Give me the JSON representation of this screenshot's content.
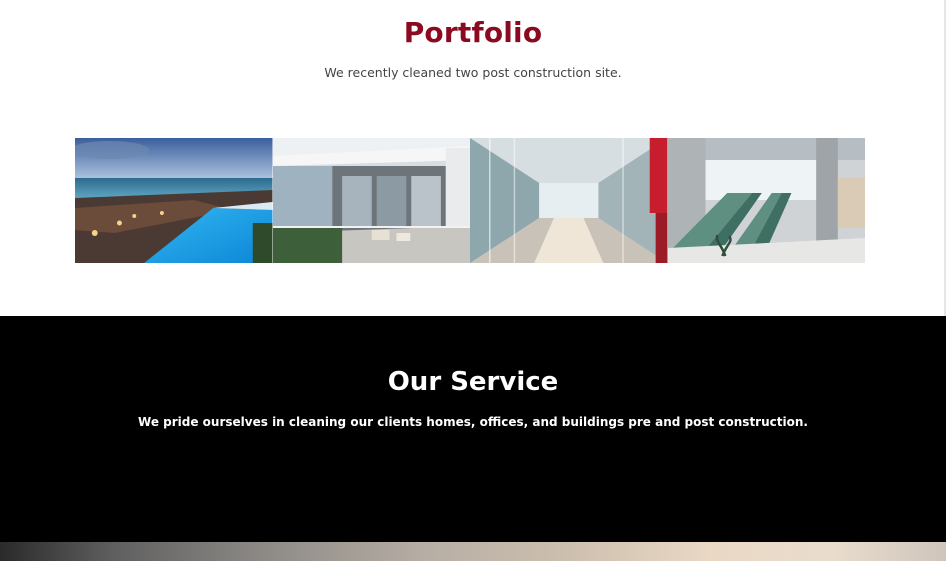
{
  "portfolio": {
    "title": "Portfolio",
    "subtitle": "We recently cleaned two post construction site.",
    "images": [
      {
        "name": "rooftop-pool-image"
      },
      {
        "name": "modern-balcony-image"
      },
      {
        "name": "glass-corridor-image"
      },
      {
        "name": "escalator-atrium-image"
      }
    ]
  },
  "service": {
    "title": "Our Service",
    "text": "We pride ourselves in cleaning our clients homes, offices, and buildings pre and post construction."
  },
  "colors": {
    "accent": "#8c0a1f",
    "service_bg": "#000000"
  }
}
